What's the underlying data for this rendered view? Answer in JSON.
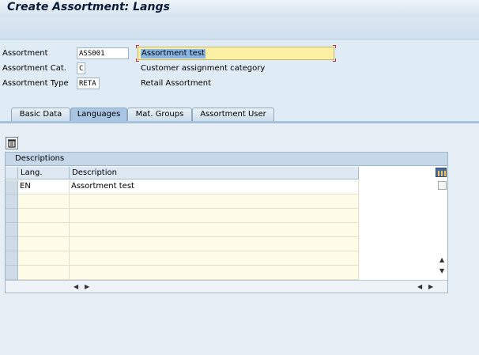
{
  "window": {
    "title": "Create Assortment: Langs"
  },
  "header": {
    "assortment_label": "Assortment",
    "assortment_value": "ASS001",
    "description_value": "Assortment test",
    "cat_label": "Assortment Cat.",
    "cat_value": "C",
    "cat_text": "Customer assignment category",
    "type_label": "Assortment Type",
    "type_value": "RETA",
    "type_text": "Retail Assortment"
  },
  "tabs": [
    {
      "label": "Basic Data",
      "active": false
    },
    {
      "label": "Languages",
      "active": true
    },
    {
      "label": "Mat. Groups",
      "active": false
    },
    {
      "label": "Assortment User",
      "active": false
    }
  ],
  "table": {
    "caption": "Descriptions",
    "columns": [
      "Lang.",
      "Description"
    ],
    "rows": [
      {
        "lang": "EN",
        "description": "Assortment test"
      },
      {
        "lang": "",
        "description": ""
      },
      {
        "lang": "",
        "description": ""
      },
      {
        "lang": "",
        "description": ""
      },
      {
        "lang": "",
        "description": ""
      },
      {
        "lang": "",
        "description": ""
      },
      {
        "lang": "",
        "description": ""
      }
    ]
  },
  "icons": {
    "delete": "trash-icon",
    "table_settings": "table-settings-icon",
    "scroll_up": "scroll-up-icon",
    "scroll_down": "scroll-down-icon",
    "scroll_left": "scroll-left-icon",
    "scroll_right": "scroll-right-icon"
  }
}
